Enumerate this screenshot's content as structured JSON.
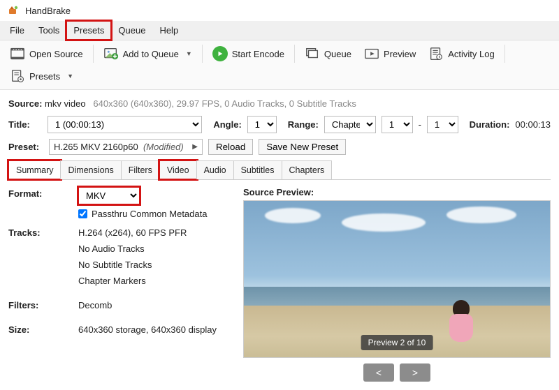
{
  "app": {
    "title": "HandBrake"
  },
  "menu": {
    "file": "File",
    "tools": "Tools",
    "presets": "Presets",
    "queue": "Queue",
    "help": "Help"
  },
  "toolbar": {
    "open_source": "Open Source",
    "add_queue": "Add to Queue",
    "start_encode": "Start Encode",
    "queue": "Queue",
    "preview": "Preview",
    "activity_log": "Activity Log",
    "presets": "Presets"
  },
  "source": {
    "label": "Source:",
    "file": "mkv video",
    "meta": "640x360 (640x360), 29.97 FPS, 0 Audio Tracks, 0 Subtitle Tracks"
  },
  "title": {
    "label": "Title:",
    "value": "1  (00:00:13)",
    "angle_label": "Angle:",
    "angle_value": "1",
    "range_label": "Range:",
    "range_type": "Chapters",
    "range_from": "1",
    "range_dash": "-",
    "range_to": "1",
    "duration_label": "Duration:",
    "duration_value": "00:00:13"
  },
  "preset": {
    "label": "Preset:",
    "value": "H.265 MKV 2160p60",
    "modified": "(Modified)",
    "reload": "Reload",
    "save_new": "Save New Preset"
  },
  "tabs": {
    "summary": "Summary",
    "dimensions": "Dimensions",
    "filters": "Filters",
    "video": "Video",
    "audio": "Audio",
    "subtitles": "Subtitles",
    "chapters": "Chapters"
  },
  "summary": {
    "format_label": "Format:",
    "format_value": "MKV",
    "passthru": "Passthru Common Metadata",
    "tracks_label": "Tracks:",
    "tracks": {
      "video": "H.264 (x264), 60 FPS PFR",
      "audio": "No Audio Tracks",
      "subs": "No Subtitle Tracks",
      "chapters": "Chapter Markers"
    },
    "filters_label": "Filters:",
    "filters_value": "Decomb",
    "size_label": "Size:",
    "size_value": "640x360 storage, 640x360 display"
  },
  "preview": {
    "label": "Source Preview:",
    "badge": "Preview 2 of 10",
    "prev": "<",
    "next": ">"
  }
}
